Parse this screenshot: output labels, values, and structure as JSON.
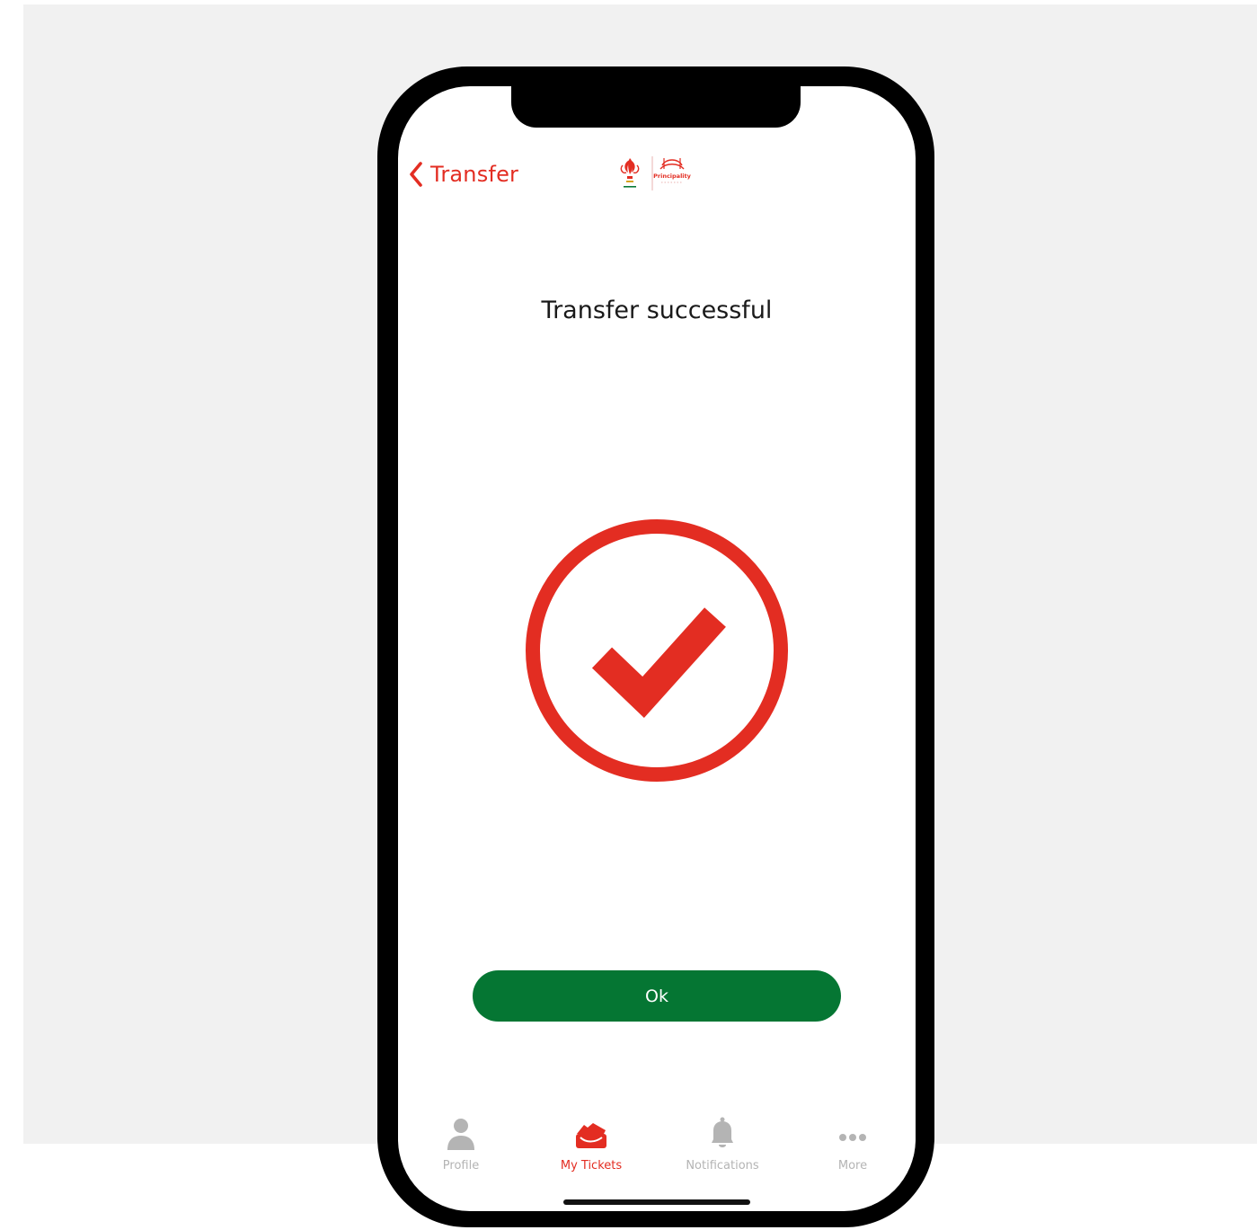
{
  "nav": {
    "back_label": "Transfer",
    "back_icon": "chevron-left-icon",
    "logo": "wru-principality-stadium-logo",
    "logo_text": "Principality"
  },
  "main": {
    "title": "Transfer successful",
    "status_icon": "check-circle-icon",
    "ok_label": "Ok"
  },
  "tabbar": {
    "items": [
      {
        "label": "Profile",
        "icon": "person-icon",
        "active": false
      },
      {
        "label": "My Tickets",
        "icon": "tickets-icon",
        "active": true
      },
      {
        "label": "Notifications",
        "icon": "bell-icon",
        "active": false
      },
      {
        "label": "More",
        "icon": "more-dots-icon",
        "active": false
      }
    ]
  },
  "colors": {
    "accent": "#e32d22",
    "button": "#057633",
    "inactive": "#b4b4b4",
    "backdrop": "#f1f1f1"
  }
}
